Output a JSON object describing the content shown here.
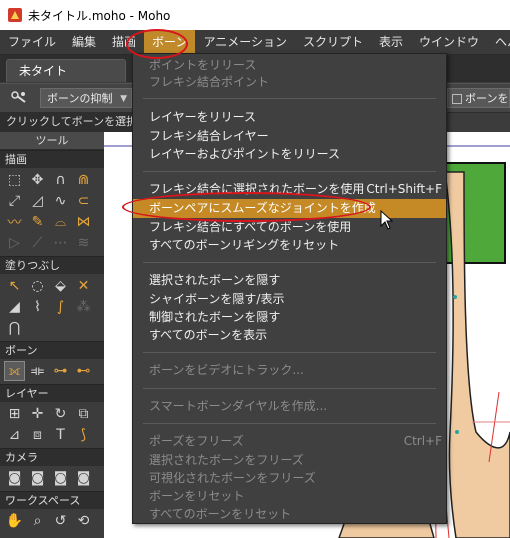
{
  "window": {
    "title": "未タイトル.moho - Moho"
  },
  "menubar": [
    "ファイル",
    "編集",
    "描画",
    "ボーン",
    "アニメーション",
    "スクリプト",
    "表示",
    "ウインドウ",
    "ヘルプ"
  ],
  "menubar_active": "ボーン",
  "document_tab": {
    "label": "未タイトル.moho"
  },
  "options_bar": {
    "constraint_select": "ボーンの抑制",
    "right_option": "ボーンをロッ"
  },
  "status_hint": "クリックしてボーンを選択（<",
  "sidebar": {
    "header": "ツール",
    "sections": [
      "描画",
      "塗りつぶし",
      "ボーン",
      "レイヤー",
      "カメラ",
      "ワークスペース"
    ]
  },
  "bone_menu": {
    "items": [
      {
        "label": "ポイントをリリース",
        "shortcut": "",
        "disabled": true
      },
      {
        "label": "フレキシ結合ポイント",
        "shortcut": "",
        "disabled": true
      },
      {
        "label": "レイヤーをリリース",
        "shortcut": "",
        "disabled": false
      },
      {
        "label": "フレキシ結合レイヤー",
        "shortcut": "",
        "disabled": false
      },
      {
        "label": "レイヤーおよびポイントをリリース",
        "shortcut": "",
        "disabled": false
      },
      {
        "label": "フレキシ結合に選択されたボーンを使用",
        "shortcut": "Ctrl+Shift+F",
        "disabled": false
      },
      {
        "label": "ボーンペアにスムーズなジョイントを作成",
        "shortcut": "",
        "disabled": false,
        "highlighted": true
      },
      {
        "label": "フレキシ結合にすべてのボーンを使用",
        "shortcut": "",
        "disabled": false
      },
      {
        "label": "すべてのボーンリギングをリセット",
        "shortcut": "",
        "disabled": false
      },
      {
        "label": "選択されたボーンを隠す",
        "shortcut": "",
        "disabled": false
      },
      {
        "label": "シャイボーンを隠す/表示",
        "shortcut": "",
        "disabled": false
      },
      {
        "label": "制御されたボーンを隠す",
        "shortcut": "",
        "disabled": false
      },
      {
        "label": "すべてのボーンを表示",
        "shortcut": "",
        "disabled": false
      },
      {
        "label": "ボーンをビデオにトラック...",
        "shortcut": "",
        "disabled": true
      },
      {
        "label": "スマートボーンダイヤルを作成...",
        "shortcut": "",
        "disabled": true
      },
      {
        "label": "ポーズをフリーズ",
        "shortcut": "Ctrl+F",
        "disabled": true
      },
      {
        "label": "選択されたボーンをフリーズ",
        "shortcut": "",
        "disabled": true
      },
      {
        "label": "可視化されたボーンをフリーズ",
        "shortcut": "",
        "disabled": true
      },
      {
        "label": "ボーンをリセット",
        "shortcut": "",
        "disabled": true
      },
      {
        "label": "すべてのボーンをリセット",
        "shortcut": "",
        "disabled": true
      }
    ]
  },
  "colors": {
    "menu_highlight": "#c58a25",
    "annotation_ring": "#d8141d",
    "canvas_skin": "#f0caa0",
    "canvas_green": "#4ea83a",
    "canvas_bone_red": "#e03030"
  }
}
